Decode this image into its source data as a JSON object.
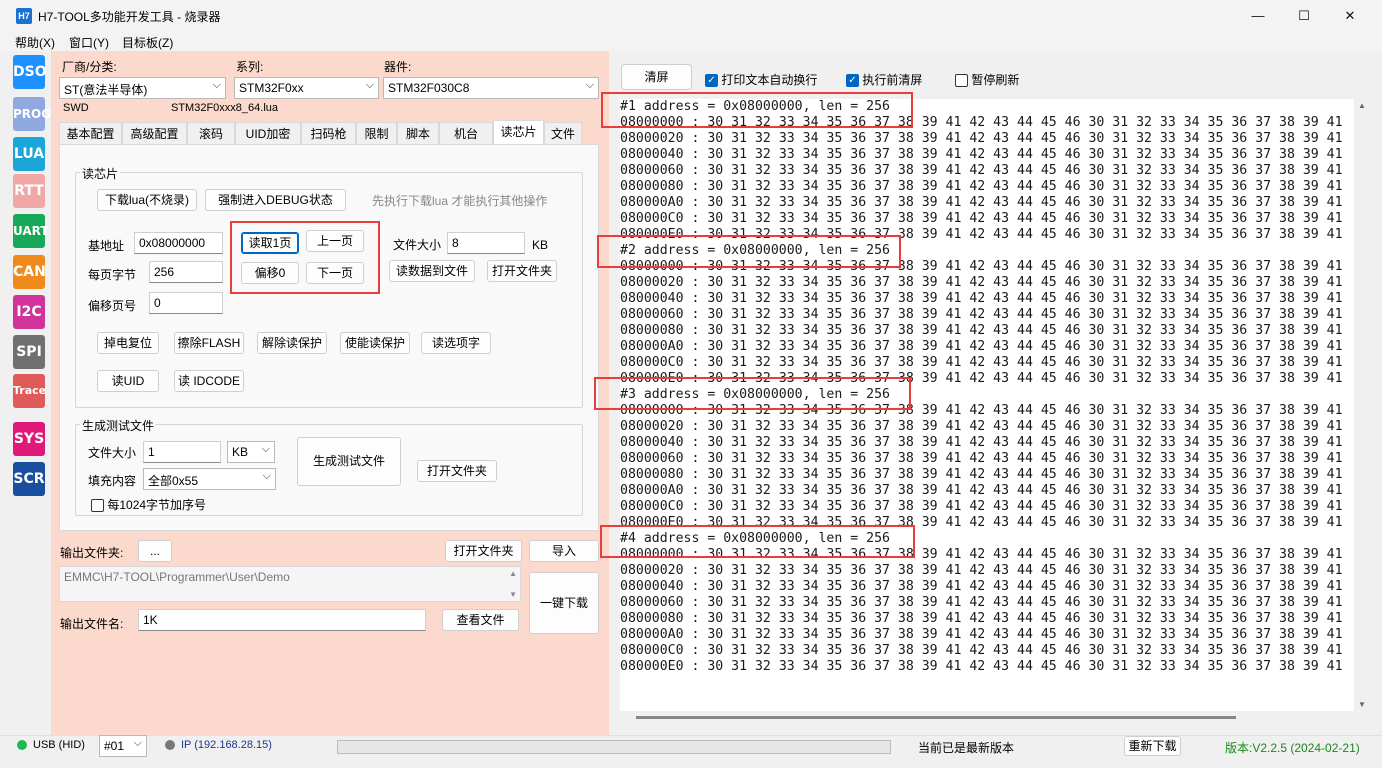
{
  "window": {
    "icon_text": "H7",
    "title": "H7-TOOL多功能开发工具 - 烧录器",
    "minimize": "—",
    "maximize": "☐",
    "close": "✕"
  },
  "menu": [
    "帮助(X)",
    "窗口(Y)",
    "目标板(Z)"
  ],
  "toolbar": [
    {
      "label": "DSO",
      "color": "#1e90ff"
    },
    {
      "label": "PROG",
      "color": "#8fa9e0"
    },
    {
      "label": "LUA",
      "color": "#1aa7d8"
    },
    {
      "label": "RTT",
      "color": "#f2a7a7"
    },
    {
      "label": "UART",
      "color": "#18a85a"
    },
    {
      "label": "CAN",
      "color": "#f08a1c"
    },
    {
      "label": "I2C",
      "color": "#d0349a"
    },
    {
      "label": "SPI",
      "color": "#707070"
    },
    {
      "label": "Trace",
      "color": "#e05a5a"
    },
    {
      "label": "SYS",
      "color": "#e0187a"
    },
    {
      "label": "SCR",
      "color": "#1a4fa0"
    }
  ],
  "selectors": {
    "vendor_label": "厂商/分类:",
    "vendor_value": "ST(意法半导体)",
    "series_label": "系列:",
    "series_value": "STM32F0xx",
    "device_label": "器件:",
    "device_value": "STM32F030C8",
    "interface": "SWD",
    "lua_file": "STM32F0xxx8_64.lua"
  },
  "tabs": [
    "基本配置",
    "高级配置",
    "滚码",
    "UID加密",
    "扫码枪",
    "限制",
    "脚本",
    "机台",
    "读芯片",
    "文件"
  ],
  "read_chip": {
    "group_title": "读芯片",
    "download_lua": "下载lua(不烧录)",
    "force_debug": "强制进入DEBUG状态",
    "hint": "先执行下载lua 才能执行其他操作",
    "base_addr_label": "基地址",
    "base_addr_value": "0x08000000",
    "page_bytes_label": "每页字节",
    "page_bytes_value": "256",
    "offset_page_label": "偏移页号",
    "offset_page_value": "0",
    "read_page1": "读取1页",
    "prev_page": "上一页",
    "offset0": "偏移0",
    "next_page": "下一页",
    "file_size_label": "文件大小",
    "file_size_value": "8",
    "file_size_unit": "KB",
    "read_to_file": "读数据到文件",
    "open_folder": "打开文件夹",
    "power_reset": "掉电复位",
    "erase_flash": "擦除FLASH",
    "unprotect": "解除读保护",
    "protect": "使能读保护",
    "read_option": "读选项字",
    "read_uid": "读UID",
    "read_idcode": "读 IDCODE"
  },
  "gen_test": {
    "group_title": "生成测试文件",
    "file_size_label": "文件大小",
    "file_size_value": "1",
    "unit_value": "KB",
    "fill_label": "填充内容",
    "fill_value": "全部0x55",
    "seq_label": "每1024字节加序号",
    "generate": "生成测试文件",
    "open_folder": "打开文件夹"
  },
  "output": {
    "folder_label": "输出文件夹:",
    "browse": "...",
    "open_folder": "打开文件夹",
    "import": "导入",
    "path": "EMMC\\H7-TOOL\\Programmer\\User\\Demo",
    "one_click": "一键下载",
    "filename_label": "输出文件名:",
    "filename_value": "1K",
    "view_file": "查看文件"
  },
  "console_toolbar": {
    "clear": "清屏",
    "auto_wrap": "打印文本自动换行",
    "clear_before": "执行前清屏",
    "pause_refresh": "暂停刷新"
  },
  "console": {
    "blocks": [
      {
        "header": "#1 address = 0x08000000, len = 256"
      },
      {
        "header": "#2 address = 0x08000000, len = 256"
      },
      {
        "header": "#3 address = 0x08000000, len = 256"
      },
      {
        "header": "#4 address = 0x08000000, len = 256"
      }
    ],
    "row_addresses": [
      "08000000",
      "08000020",
      "08000040",
      "08000060",
      "08000080",
      "080000A0",
      "080000C0",
      "080000E0"
    ],
    "row_bytes": "30 31 32 33 34 35 36 37 38 39 41 42 43 44 45 46 30 31 32 33 34 35 36 37 38 39 41"
  },
  "status": {
    "usb": "USB (HID)",
    "device_no": "#01",
    "ip": "IP (192.168.28.15)",
    "latest": "当前已是最新版本",
    "redownload": "重新下载",
    "version": "版本:V2.2.5 (2024-02-21)"
  }
}
